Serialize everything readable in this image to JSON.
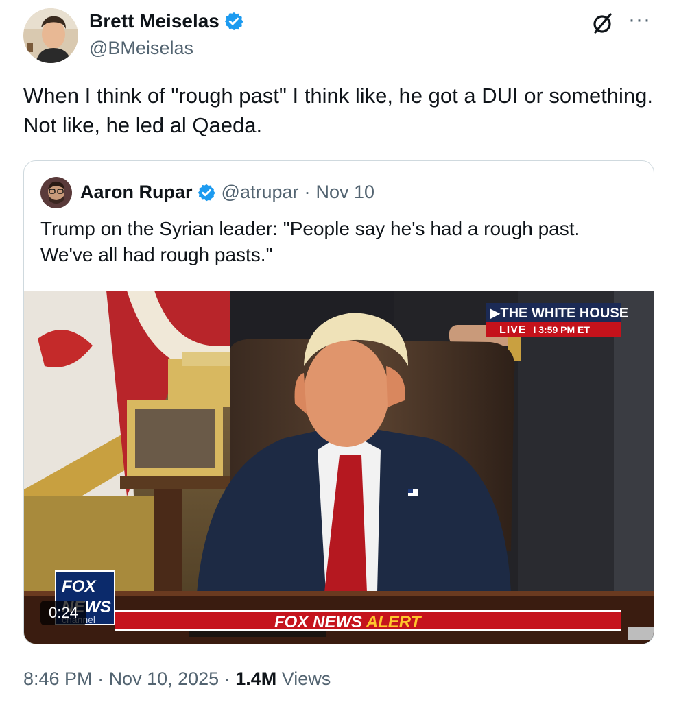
{
  "author": {
    "name": "Brett Meiselas",
    "handle": "@BMeiselas",
    "verified": true,
    "badge_color": "#1d9bf0"
  },
  "tweet": {
    "text": "When I think of \"rough past\" I think like, he got a DUI or something. Not like, he led al Qaeda."
  },
  "icons": {
    "grok": "grok-icon",
    "more": "more-icon",
    "more_glyph": "···"
  },
  "quote": {
    "name": "Aaron Rupar",
    "handle": "@atrupar",
    "separator": "·",
    "date": "Nov 10",
    "verified": true,
    "text": "Trump on the Syrian leader: \"People say he's had a rough past. We've all had rough pasts.\"",
    "video": {
      "banner_title": "▶THE WHITE HOUSE",
      "banner_live": "LIVE",
      "banner_time": "I 3:59 PM ET",
      "logo_fox": "FOX",
      "logo_news": "NEWS",
      "logo_channel": "channel",
      "alert_prefix": "FOX NEWS",
      "alert_word": "ALERT",
      "duration": "0:24"
    }
  },
  "meta": {
    "time": "8:46 PM",
    "sep1": " · ",
    "date": "Nov 10, 2025",
    "sep2": " · ",
    "views_count": "1.4M",
    "views_label": " Views"
  }
}
